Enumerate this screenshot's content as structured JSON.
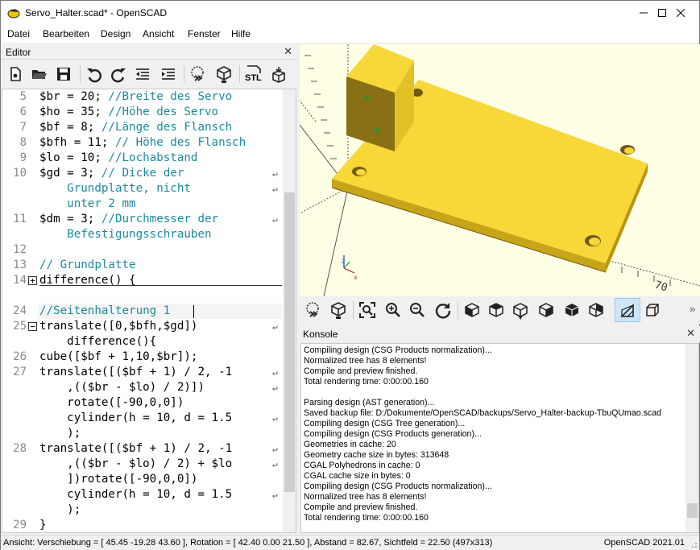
{
  "window": {
    "title": "Servo_Halter.scad* - OpenSCAD",
    "min_label": "—",
    "max_label": "☐",
    "close_label": "✕"
  },
  "menu": [
    "Datei",
    "Bearbeiten",
    "Design",
    "Ansicht",
    "Fenster",
    "Hilfe"
  ],
  "editor": {
    "title": "Editor",
    "close": "✕",
    "toolbar_icons": [
      "new-file-icon",
      "open-file-icon",
      "save-icon",
      "undo-icon",
      "redo-icon",
      "unindent-icon",
      "indent-icon",
      "preview-icon",
      "render-icon",
      "export-stl-icon",
      "send-to-printer-icon"
    ],
    "stl_label": "STL",
    "lines": [
      {
        "ln": "5",
        "code": "$br = 20; ",
        "comment": "//Breite des Servo"
      },
      {
        "ln": "6",
        "code": "$ho = 35; ",
        "comment": "//Höhe des Servo"
      },
      {
        "ln": "7",
        "code": "$bf = 8; ",
        "comment": "//Länge des Flansch"
      },
      {
        "ln": "8",
        "code": "$bfh = 11; ",
        "comment": "// Höhe des Flansch"
      },
      {
        "ln": "9",
        "code": "$lo = 10; ",
        "comment": "//Lochabstand"
      },
      {
        "ln": "10",
        "code": "$gd = 3; ",
        "comment": "// Dicke der"
      },
      {
        "ln": "",
        "code": "    ",
        "comment": "Grundplatte, nicht"
      },
      {
        "ln": "",
        "code": "    ",
        "comment": "unter 2 mm"
      },
      {
        "ln": "11",
        "code": "$dm = 3; ",
        "comment": "//Durchmesser der"
      },
      {
        "ln": "",
        "code": "    ",
        "comment": "Befestigungsschrauben"
      },
      {
        "ln": "12",
        "code": "",
        "comment": ""
      },
      {
        "ln": "13",
        "code": "",
        "comment": "// Grundplatte"
      },
      {
        "ln": "14",
        "code": "difference() {",
        "comment": ""
      },
      {
        "ln": "",
        "code": "",
        "comment": ""
      },
      {
        "ln": "24",
        "code": "",
        "comment": "//Seitenhalterung 1"
      },
      {
        "ln": "25",
        "code": "translate([0,$bfh,$gd])",
        "comment": ""
      },
      {
        "ln": "",
        "code": "    difference(){",
        "comment": ""
      },
      {
        "ln": "26",
        "code": "cube([$bf + 1,10,$br]);",
        "comment": ""
      },
      {
        "ln": "27",
        "code": "translate([($bf + 1) / 2, -1",
        "comment": ""
      },
      {
        "ln": "",
        "code": "    ,(($br - $lo) / 2)])",
        "comment": ""
      },
      {
        "ln": "",
        "code": "    rotate([-90,0,0])",
        "comment": ""
      },
      {
        "ln": "",
        "code": "    cylinder(h = 10, d = 1.5",
        "comment": ""
      },
      {
        "ln": "",
        "code": "    );",
        "comment": ""
      },
      {
        "ln": "28",
        "code": "translate([($bf + 1) / 2, -1",
        "comment": ""
      },
      {
        "ln": "",
        "code": "    ,(($br - $lo) / 2) + $lo",
        "comment": ""
      },
      {
        "ln": "",
        "code": "    ])rotate([-90,0,0])",
        "comment": ""
      },
      {
        "ln": "",
        "code": "    cylinder(h = 10, d = 1.5",
        "comment": ""
      },
      {
        "ln": "",
        "code": "    );",
        "comment": ""
      },
      {
        "ln": "29",
        "code": "}",
        "comment": ""
      }
    ],
    "fold_plus": "+",
    "fold_minus": "−"
  },
  "viewport": {
    "axis_label": "70",
    "colors": {
      "background": "#ffffe5",
      "model_top": "#f8d838",
      "model_side": "#c8a418",
      "model_dark": "#6e5a10"
    }
  },
  "view_toolbar_icons": [
    "preview-icon",
    "render-icon",
    "view-all-icon",
    "zoom-in-icon",
    "zoom-out-icon",
    "reset-view-icon",
    "view-right-icon",
    "view-top-icon",
    "view-bottom-icon",
    "view-left-icon",
    "view-front-icon",
    "view-back-icon",
    "perspective-icon",
    "orthogonal-icon"
  ],
  "view_toolbar_more": "»",
  "console": {
    "title": "Konsole",
    "close": "✕",
    "lines": [
      "Compiling design (CSG Products normalization)...",
      "Normalized tree has 8 elements!",
      "Compile and preview finished.",
      "Total rendering time: 0:00:00.160",
      "",
      "Parsing design (AST generation)...",
      "Saved backup file: D:/Dokumente/OpenSCAD/backups/Servo_Halter-backup-TbuQUmao.scad",
      "Compiling design (CSG Tree generation)...",
      "Compiling design (CSG Products generation)...",
      "Geometries in cache: 20",
      "Geometry cache size in bytes: 313648",
      "CGAL Polyhedrons in cache: 0",
      "CGAL cache size in bytes: 0",
      "Compiling design (CSG Products normalization)...",
      "Normalized tree has 8 elements!",
      "Compile and preview finished.",
      "Total rendering time: 0:00:00.160"
    ]
  },
  "status": {
    "left": "Ansicht: Verschiebung = [ 45.45 -19.28 43.60 ], Rotation = [ 42.40 0.00 21.50 ], Abstand = 82.67, Sichtfeld = 22.50 (497x313)",
    "right": "OpenSCAD 2021.01"
  }
}
